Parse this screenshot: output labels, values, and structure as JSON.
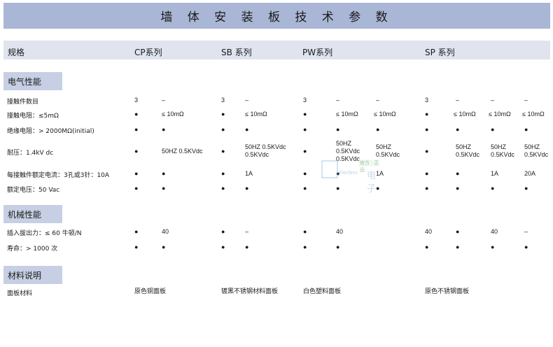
{
  "title": "墙 体 安 装 板 技 术 参 数",
  "header": {
    "spec": "规格",
    "cp": "CP系列",
    "sb": "SB 系列",
    "pw": "PW系列",
    "sp": "SP 系列"
  },
  "sections": {
    "electrical": "电气性能",
    "mechanical": "机械性能",
    "material": "材料说明"
  },
  "rows": {
    "contacts": "接触件数目",
    "contact_resistance": "接触电阻：≤5mΩ",
    "insulation": "绝缘电阻：> 2000MΩ(initial)",
    "withstand": "耐压：1.4kV dc",
    "current": "每接触件额定电流：3孔或3针：10A",
    "voltage": "额定电压：50 Vac",
    "insertion": "插入拔出力：≤ 60 牛顿/N",
    "life": "寿命：> 1000 次",
    "panel": "面板材料"
  },
  "values": {
    "three": "3",
    "dash": "–",
    "dot": "●",
    "res": "≤ 10mΩ",
    "hz_combined": "50HZ 0.5KVdc",
    "hz": "50HZ",
    "kv": "0.5KVdc",
    "a1": "1A",
    "a20": "20A",
    "forty": "40",
    "cp_material": "原色铜面板",
    "sb_material": "镀黑不锈钢材料面板",
    "pw_material": "白色塑料面板",
    "sp_material": "原色不锈钢面板"
  },
  "watermark": {
    "text1": "官方 · 正品",
    "text2": "Elecfans",
    "text3": "电子"
  }
}
